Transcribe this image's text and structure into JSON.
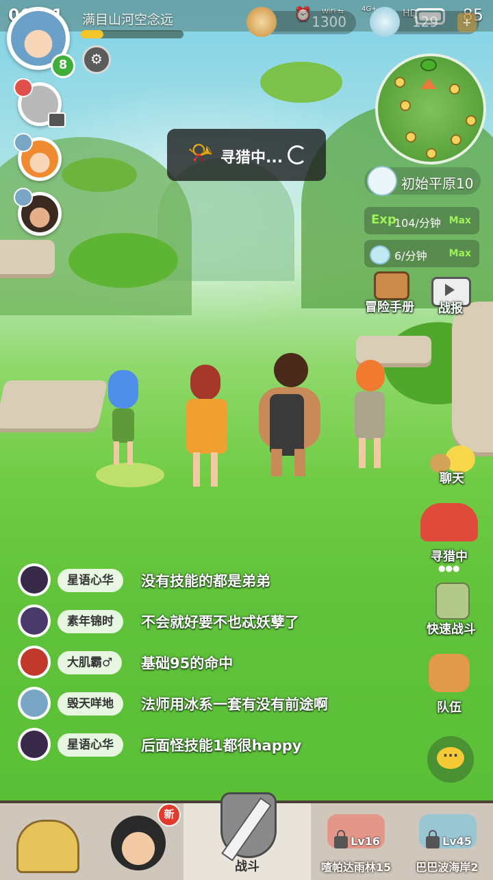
{
  "status_bar": {
    "time": "00:01",
    "wifi_label": "WiFi",
    "network_label": "4G+",
    "hd_label": "HD",
    "battery": "85"
  },
  "player": {
    "name": "满目山河空念远",
    "level": "8",
    "exp_fraction": 0.22
  },
  "currencies": [
    {
      "name": "shell",
      "value": "1300"
    },
    {
      "name": "gem",
      "value": "129"
    }
  ],
  "hunting_toast": {
    "text": "寻猎中..."
  },
  "location": {
    "name": "初始平原10"
  },
  "rates": {
    "exp_label": "Exp",
    "exp_rate": "104/分钟",
    "exp_max": "Max",
    "gem_rate": "6/分钟",
    "gem_max": "Max"
  },
  "side_buttons": {
    "handbook": "冒险手册",
    "battle_report": "战报",
    "chat": "聊天",
    "hunting": "寻猎中",
    "quick_battle": "快速战斗",
    "team": "队伍"
  },
  "chat_messages": [
    {
      "name": "星语心华",
      "message": "没有技能的都是弟弟",
      "avatar_color": "#3a2a4a"
    },
    {
      "name": "素年锦时",
      "message": "不会就好要不也忒妖孽了",
      "avatar_color": "#4a3a6a"
    },
    {
      "name": "大肌霸♂",
      "message": "基础95的命中",
      "avatar_color": "#c0392b"
    },
    {
      "name": "毁天咩地",
      "message": "法师用冰系一套有没有前途啊",
      "avatar_color": "#7aa6c6"
    },
    {
      "name": "星语心华",
      "message": "后面怪技能1都很happy",
      "avatar_color": "#3a2a4a"
    }
  ],
  "bottom_nav": {
    "new_badge": "新",
    "battle": "战斗",
    "area1": {
      "level": "Lv16",
      "name": "喳帕达雨林15"
    },
    "area2": {
      "level": "Lv45",
      "name": "巴巴波海岸2"
    }
  },
  "colors": {
    "accent_green": "#9ef25a",
    "level_badge": "#3fae3a",
    "exp_fill": "#f3c62a"
  }
}
